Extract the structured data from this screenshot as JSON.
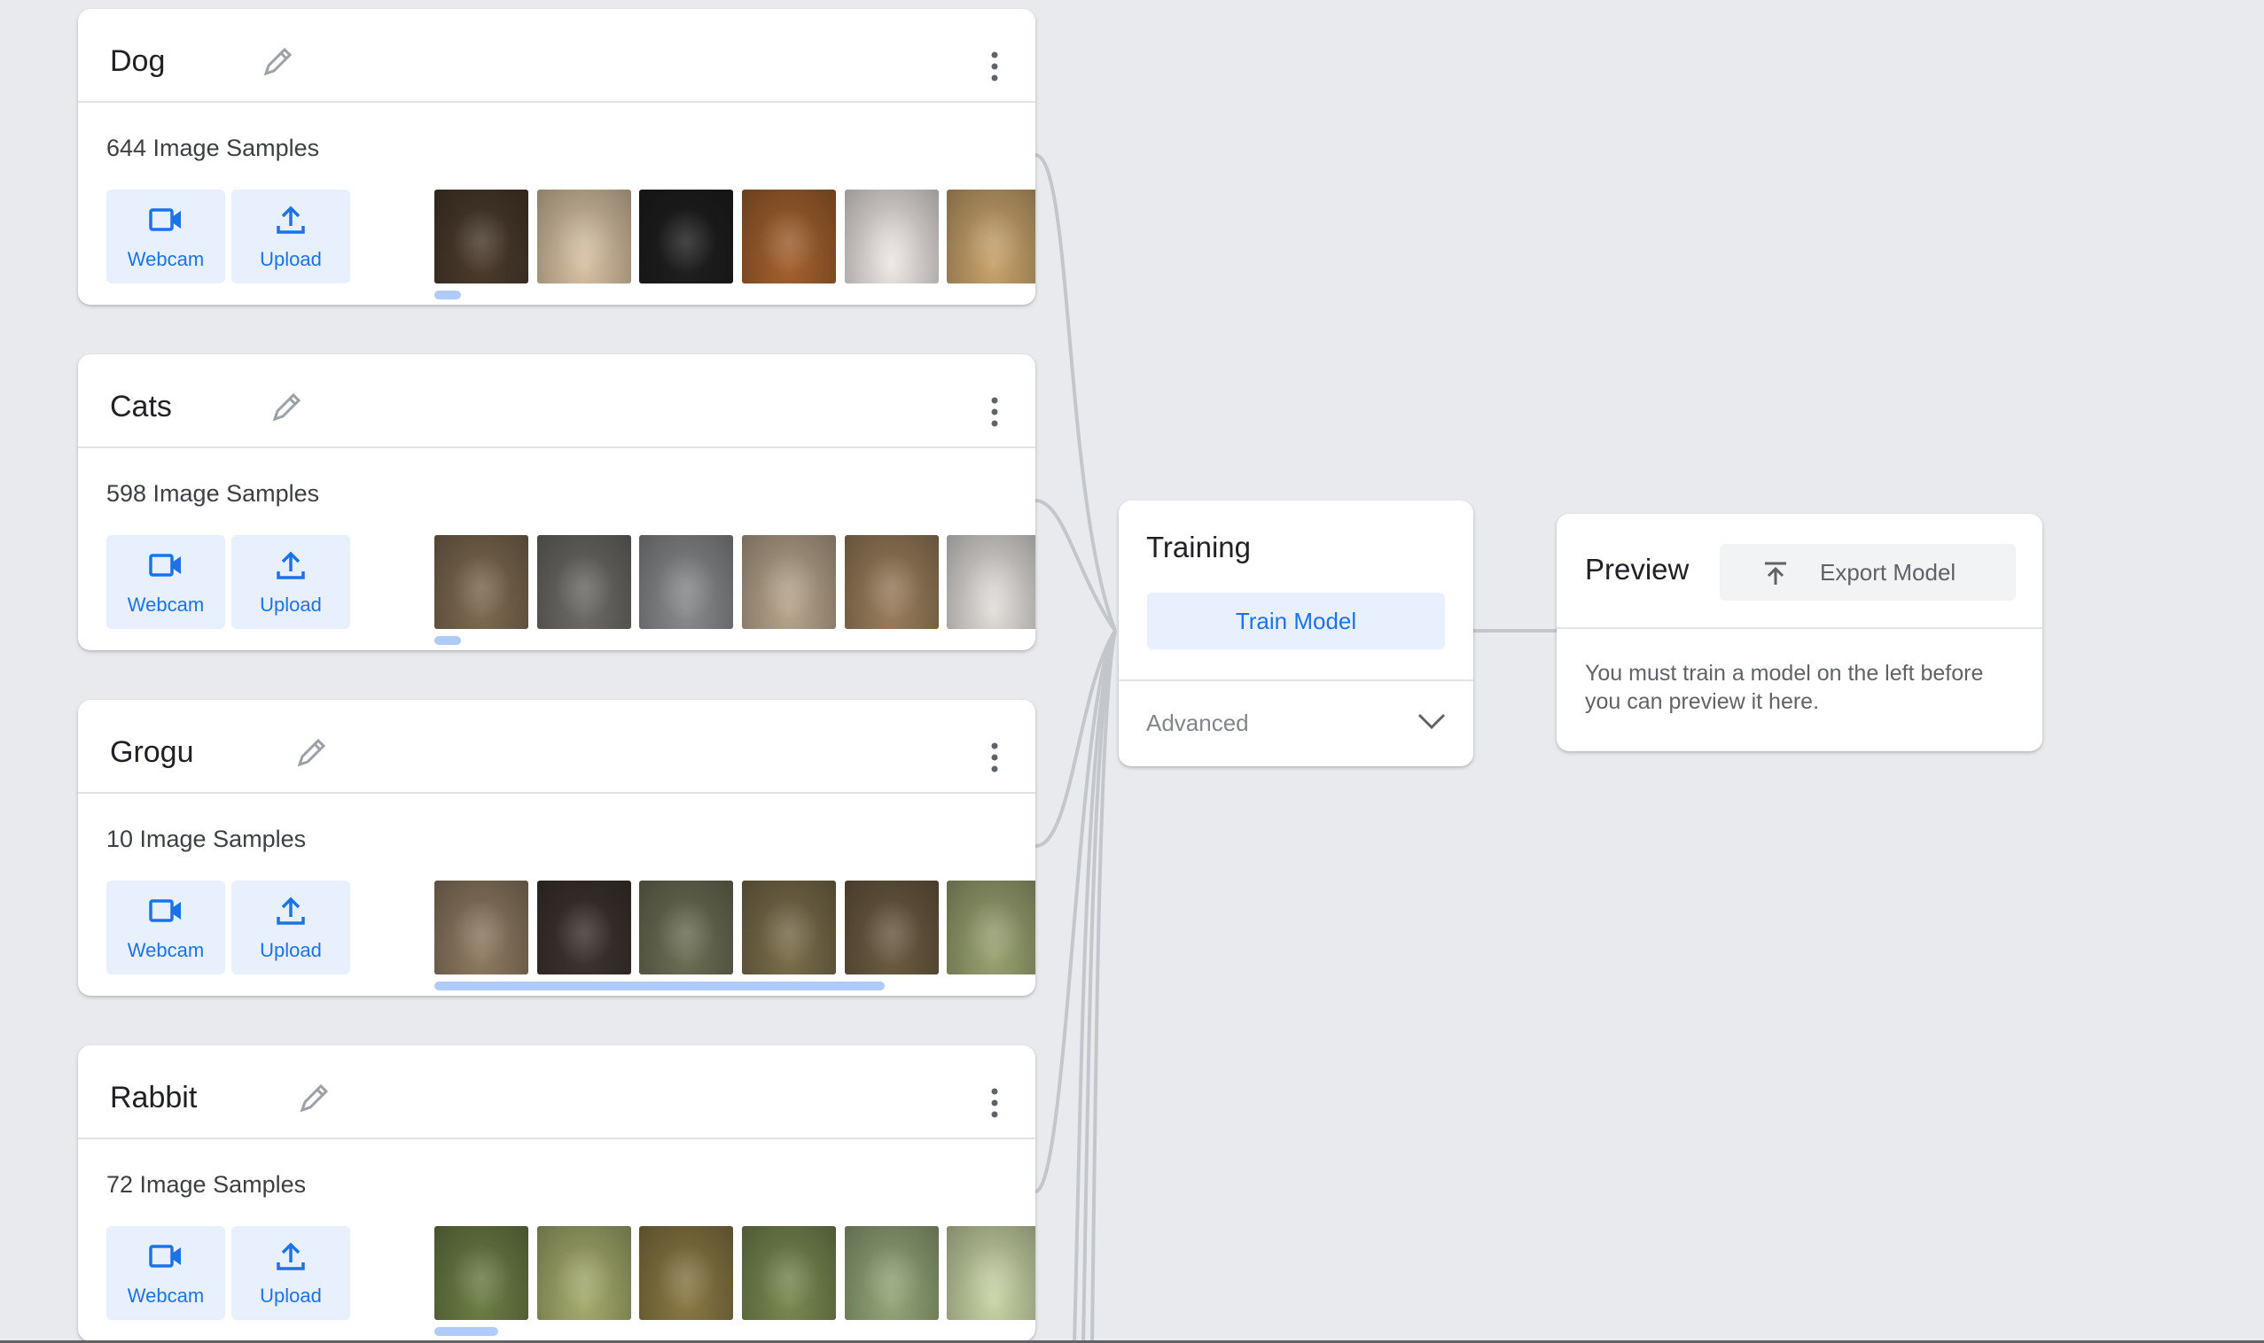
{
  "classes": [
    {
      "name": "Dog",
      "samples_label": "644 Image Samples",
      "webcam_label": "Webcam",
      "upload_label": "Upload"
    },
    {
      "name": "Cats",
      "samples_label": "598 Image Samples",
      "webcam_label": "Webcam",
      "upload_label": "Upload"
    },
    {
      "name": "Grogu",
      "samples_label": "10 Image Samples",
      "webcam_label": "Webcam",
      "upload_label": "Upload"
    },
    {
      "name": "Rabbit",
      "samples_label": "72 Image Samples",
      "webcam_label": "Webcam",
      "upload_label": "Upload"
    }
  ],
  "training": {
    "title": "Training",
    "train_button": "Train Model",
    "advanced_label": "Advanced"
  },
  "preview": {
    "title": "Preview",
    "export_button": "Export Model",
    "message": "You must train a model on the left before you can preview it here."
  },
  "icons": {
    "webcam": "videocam-icon",
    "upload": "upload-icon",
    "edit": "pencil-icon",
    "more": "more-vert-icon",
    "advanced": "chevron-down-icon",
    "export": "export-icon"
  },
  "colors": {
    "accent": "#1a73e8",
    "accent_light": "#e8f0fe",
    "scrollbar": "#aecbfa",
    "background": "#e8eaed",
    "connector": "#bdc1c6"
  }
}
